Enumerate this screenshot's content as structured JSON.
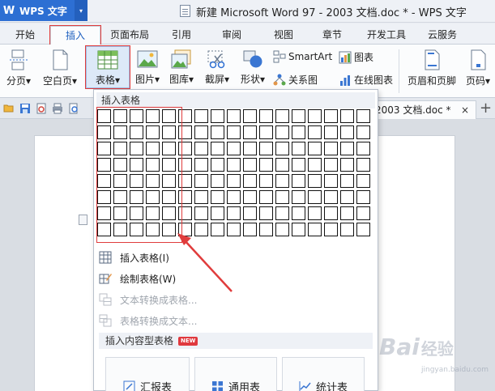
{
  "titlebar": {
    "app_logo": "W",
    "app_name": "WPS 文字",
    "window_title": "新建 Microsoft Word 97 - 2003 文档.doc * - WPS 文字"
  },
  "menu": {
    "tabs": [
      "开始",
      "插入",
      "页面布局",
      "引用",
      "审阅",
      "视图",
      "章节",
      "开发工具",
      "云服务"
    ],
    "active": "插入"
  },
  "ribbon": {
    "page_break": "分页",
    "blank_page": "空白页",
    "table": "表格",
    "picture": "图片",
    "gallery": "图库",
    "screenshot": "截屏",
    "shape": "形状",
    "smartart": "SmartArt",
    "chart": "图表",
    "relation": "关系图",
    "online_chart": "在线图表",
    "header_footer": "页眉和页脚",
    "page_number": "页码",
    "dropdown_arrow": "▾"
  },
  "doc_tab": {
    "label": "2003 文档.doc *",
    "close": "×",
    "add": "+"
  },
  "dropdown": {
    "header": "插入表格",
    "grid": {
      "cols": 17,
      "rows": 8,
      "selected_cols": 5,
      "selected_rows": 8
    },
    "items": [
      {
        "label": "插入表格(I)",
        "enabled": true,
        "icon": "table-icon"
      },
      {
        "label": "绘制表格(W)",
        "enabled": true,
        "icon": "pencil-table-icon"
      },
      {
        "label": "文本转换成表格...",
        "enabled": false,
        "icon": "text-to-table-icon"
      },
      {
        "label": "表格转换成文本...",
        "enabled": false,
        "icon": "table-to-text-icon"
      }
    ],
    "section": "插入内容型表格",
    "section_badge": "NEW",
    "cards": [
      {
        "label": "汇报表",
        "icon": "report-icon"
      },
      {
        "label": "通用表",
        "icon": "grid-icon"
      },
      {
        "label": "统计表",
        "icon": "stats-icon"
      }
    ]
  },
  "watermark": {
    "text": "Bai",
    "sub": "经验",
    "url": "jingyan.baidu.com"
  },
  "colors": {
    "accent": "#2d6fd3",
    "highlight": "#e03c3c"
  }
}
